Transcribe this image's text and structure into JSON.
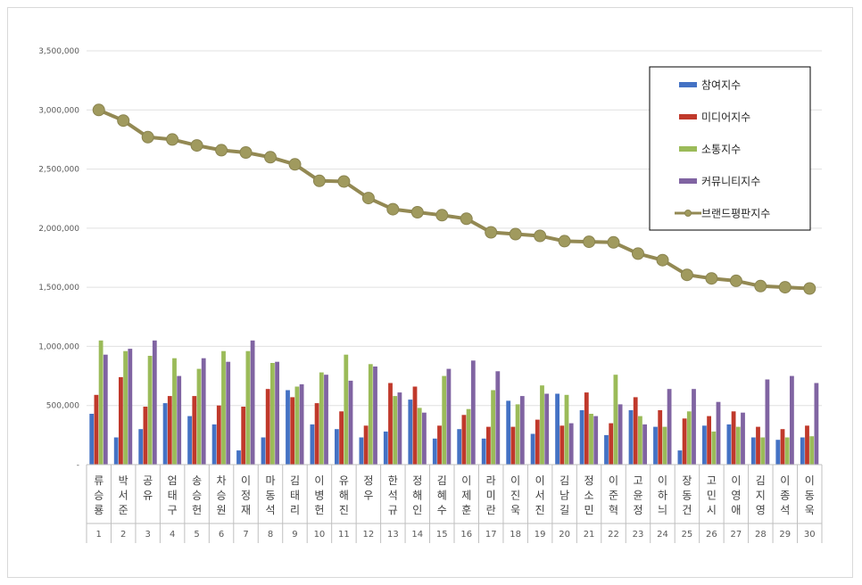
{
  "chart_data": {
    "type": "bar",
    "title": "",
    "xlabel": "",
    "ylabel": "",
    "ylim": [
      0,
      3500000
    ],
    "yticks": [
      "-",
      "500,000",
      "1,000,000",
      "1,500,000",
      "2,000,000",
      "2,500,000",
      "3,000,000",
      "3,500,000"
    ],
    "grid": true,
    "legend_position": "top-right",
    "categories": [
      "류승룡",
      "박서준",
      "공유",
      "엄태구",
      "송승헌",
      "차승원",
      "이정재",
      "마동석",
      "김태리",
      "이병헌",
      "유해진",
      "정우",
      "한석규",
      "정해인",
      "김혜수",
      "이제훈",
      "라미란",
      "이진욱",
      "이서진",
      "김남길",
      "정소민",
      "이준혁",
      "고윤정",
      "이하늬",
      "장동건",
      "고민시",
      "이영애",
      "김지영",
      "이종석",
      "이동욱"
    ],
    "ranks": [
      "1",
      "2",
      "3",
      "4",
      "5",
      "6",
      "7",
      "8",
      "9",
      "10",
      "11",
      "12",
      "13",
      "14",
      "15",
      "16",
      "17",
      "18",
      "19",
      "20",
      "21",
      "22",
      "23",
      "24",
      "25",
      "26",
      "27",
      "28",
      "29",
      "30"
    ],
    "series": [
      {
        "name": "참여지수",
        "color": "#4472c4",
        "kind": "bar",
        "values": [
          430000,
          230000,
          300000,
          520000,
          410000,
          340000,
          120000,
          230000,
          630000,
          340000,
          300000,
          230000,
          280000,
          550000,
          220000,
          300000,
          220000,
          540000,
          260000,
          600000,
          460000,
          250000,
          460000,
          320000,
          120000,
          330000,
          340000,
          230000,
          210000,
          230000
        ]
      },
      {
        "name": "미디어지수",
        "color": "#c0392b",
        "kind": "bar",
        "values": [
          590000,
          740000,
          490000,
          580000,
          580000,
          500000,
          490000,
          640000,
          570000,
          520000,
          450000,
          330000,
          690000,
          660000,
          330000,
          420000,
          320000,
          320000,
          380000,
          330000,
          610000,
          350000,
          570000,
          460000,
          390000,
          410000,
          450000,
          320000,
          300000,
          330000
        ]
      },
      {
        "name": "소통지수",
        "color": "#9bbb59",
        "kind": "bar",
        "values": [
          1050000,
          960000,
          920000,
          900000,
          810000,
          960000,
          960000,
          860000,
          660000,
          780000,
          930000,
          850000,
          580000,
          480000,
          750000,
          470000,
          630000,
          510000,
          670000,
          590000,
          430000,
          760000,
          410000,
          320000,
          450000,
          280000,
          320000,
          230000,
          230000,
          240000
        ]
      },
      {
        "name": "커뮤니티지수",
        "color": "#8064a2",
        "kind": "bar",
        "values": [
          930000,
          980000,
          1050000,
          750000,
          900000,
          870000,
          1050000,
          870000,
          680000,
          760000,
          710000,
          830000,
          610000,
          440000,
          810000,
          880000,
          790000,
          580000,
          600000,
          350000,
          410000,
          510000,
          340000,
          640000,
          640000,
          530000,
          440000,
          720000,
          750000,
          690000
        ]
      },
      {
        "name": "브랜드평판지수",
        "color": "#938953",
        "kind": "line",
        "values": [
          3000000,
          2910000,
          2770000,
          2750000,
          2700000,
          2660000,
          2640000,
          2600000,
          2540000,
          2400000,
          2395000,
          2255000,
          2160000,
          2135000,
          2110000,
          2080000,
          1965000,
          1950000,
          1935000,
          1890000,
          1885000,
          1880000,
          1785000,
          1730000,
          1605000,
          1575000,
          1555000,
          1510000,
          1500000,
          1490000
        ]
      }
    ]
  }
}
